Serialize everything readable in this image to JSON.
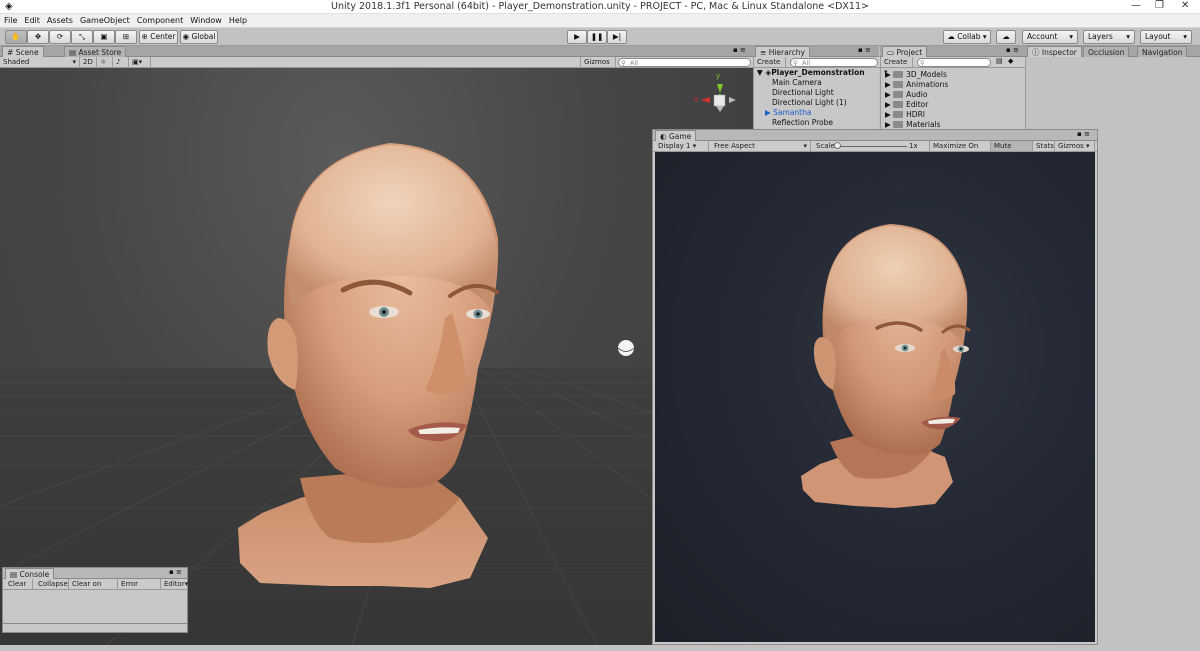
{
  "window": {
    "title": "Unity 2018.1.3f1 Personal (64bit) - Player_Demonstration.unity - PROJECT - PC, Mac & Linux Standalone <DX11>"
  },
  "menu": [
    "File",
    "Edit",
    "Assets",
    "GameObject",
    "Component",
    "Window",
    "Help"
  ],
  "toolbar": {
    "pivot": "Center",
    "space": "Global",
    "collab": "Collab ▾",
    "account": "Account",
    "layers": "Layers",
    "layout": "Layout"
  },
  "scene": {
    "tabs": [
      "Scene",
      "Asset Store"
    ],
    "shading": "Shaded",
    "mode2d": "2D",
    "gizmos": "Gizmos",
    "search_placeholder": "All",
    "gizmo_labels": {
      "y": "y",
      "x": "x"
    }
  },
  "hierarchy": {
    "tab": "Hierarchy",
    "create": "Create",
    "search_placeholder": "All",
    "scene_name": "Player_Demonstration",
    "items": [
      "Main Camera",
      "Directional Light",
      "Directional Light (1)",
      "Samantha",
      "Reflection Probe"
    ]
  },
  "project": {
    "tab": "Project",
    "create": "Create",
    "folders": [
      "3D_Models",
      "Animations",
      "Audio",
      "Editor",
      "HDRI",
      "Materials"
    ]
  },
  "inspector": {
    "tabs": [
      "Inspector",
      "Occlusion",
      "Navigation"
    ]
  },
  "game": {
    "tab": "Game",
    "display": "Display 1",
    "aspect": "Free Aspect",
    "scale_label": "Scale",
    "scale_value": "1x",
    "maximize": "Maximize On Play",
    "mute": "Mute Audio",
    "stats": "Stats",
    "gizmos": "Gizmos"
  },
  "console": {
    "tab": "Console",
    "buttons": [
      "Clear",
      "Collapse",
      "Clear on Play",
      "Error Pause",
      "Editor"
    ]
  },
  "colors": {
    "skin_light": "#e2b597",
    "skin_mid": "#c98d6a",
    "skin_dark": "#a86848",
    "gizmo_y": "#7ec82e",
    "gizmo_x": "#d53030",
    "selected_text": "#1b5cc8"
  }
}
